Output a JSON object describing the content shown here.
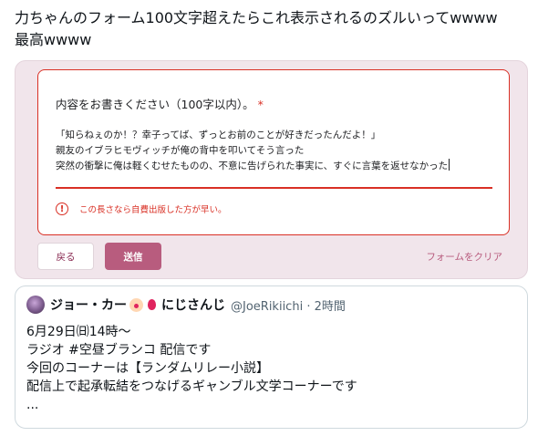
{
  "tweet": {
    "text": "力ちゃんのフォーム100文字超えたらこれ表示されるのズルいってwwww\n最高wwww"
  },
  "form": {
    "question_label": "内容をお書きください（100字以内）。",
    "required_mark": "*",
    "answer_lines": [
      "「知らねぇのか！？幸子ってば、ずっとお前のことが好きだったんだよ！」",
      "親友のイブラヒモヴィッチが俺の背中を叩いてそう言った",
      "突然の衝撃に俺は軽くむせたものの、不意に告げられた事実に、すぐに言葉を返せなかった"
    ],
    "error_icon_glyph": "!",
    "error_text": "この長さなら自費出版した方が早い。",
    "back_label": "戻る",
    "submit_label": "送信",
    "clear_label": "フォームをクリア",
    "colors": {
      "accent": "#b85c7e",
      "error": "#d93025",
      "card_bg": "#f1e5eb"
    }
  },
  "quote": {
    "author_name": "ジョー・カー",
    "author_suffix": "にじさんじ",
    "author_handle": "@JoeRikiichi · 2時間",
    "body_lines": [
      "6月29日㈰14時〜",
      "ラジオ #空昼ブランコ 配信です",
      "今回のコーナーは【ランダムリレー小説】",
      "配信上で起承転結をつなげるギャンブル文学コーナーです",
      "..."
    ]
  }
}
